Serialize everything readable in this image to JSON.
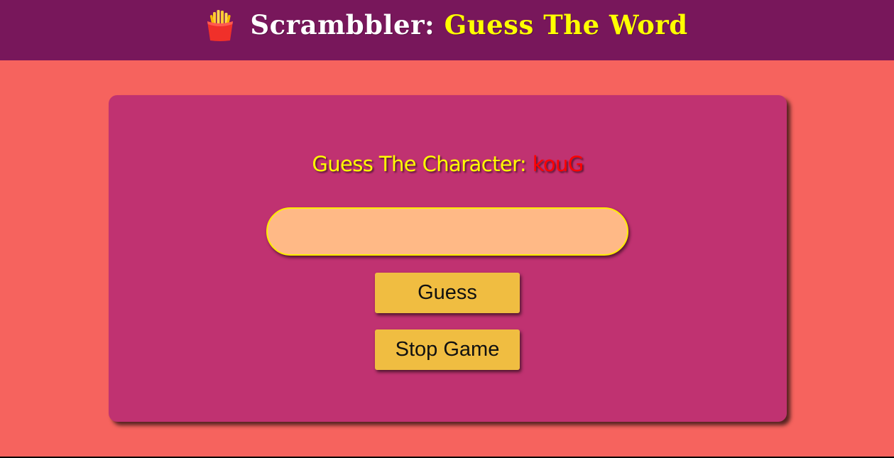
{
  "header": {
    "logo_icon": "french-fries-icon",
    "title_prefix": "Scrambbler:",
    "title_accent": "Guess The Word"
  },
  "game": {
    "prompt_label": "Guess The Character:",
    "scrambled_word": "kouG",
    "input_value": "",
    "input_placeholder": "",
    "guess_label": "Guess",
    "stop_label": "Stop Game"
  },
  "colors": {
    "page_background": "#f6635e",
    "header_background": "#78175b",
    "card_background": "#c03271",
    "title_accent": "#ffff00",
    "prompt_label": "#ffff00",
    "scrambled_word": "#ff0000",
    "input_background": "#ffb986",
    "input_border": "#ffee00",
    "button_background": "#f0bd41"
  }
}
